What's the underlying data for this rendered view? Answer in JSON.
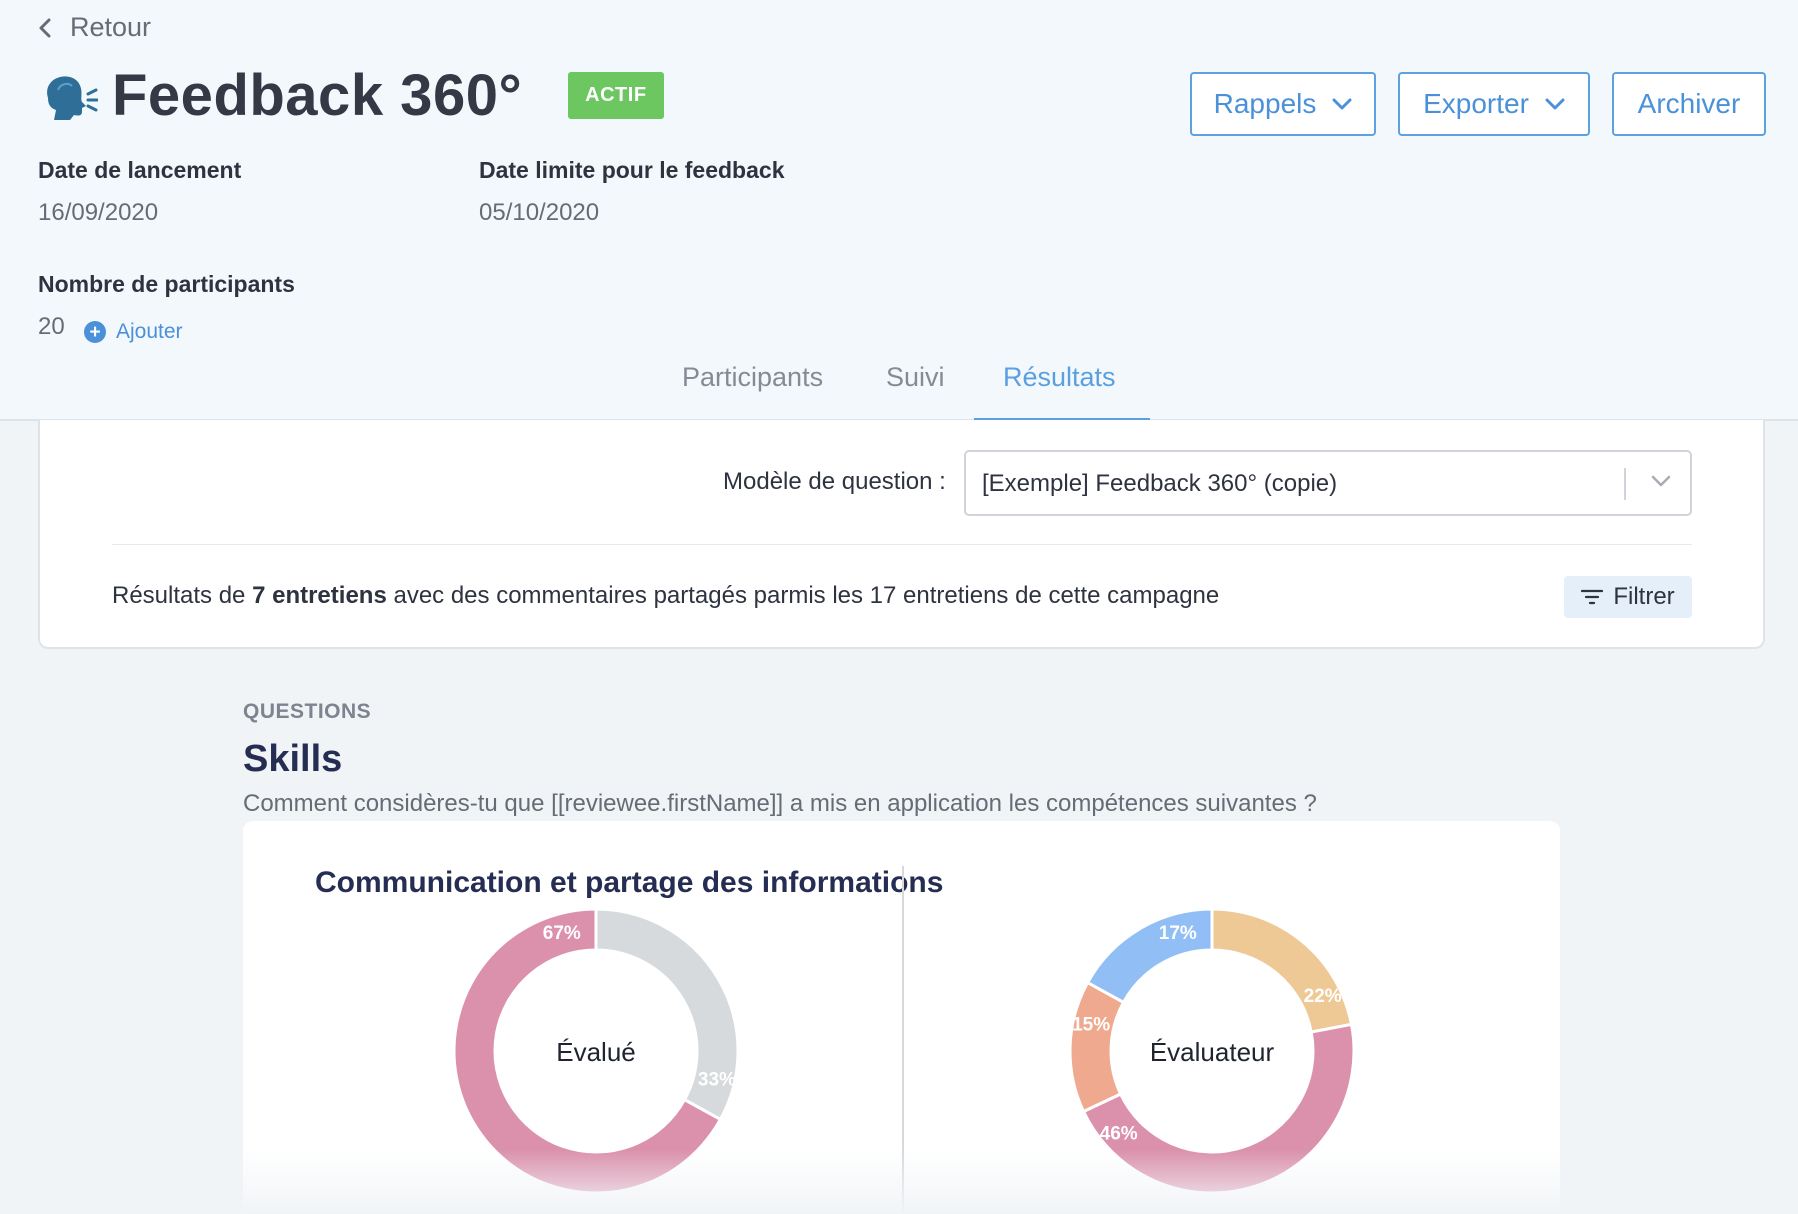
{
  "back": {
    "label": "Retour",
    "icon": "chevron-left-icon"
  },
  "title": {
    "emoji": "speaking-head-icon",
    "text": "Feedback 360°",
    "status": "ACTIF",
    "status_color": "#6cc760"
  },
  "actions": {
    "rappels": "Rappels",
    "exporter": "Exporter",
    "archiver": "Archiver",
    "accent_color": "#4a91d9"
  },
  "meta": {
    "launch_label": "Date de lancement",
    "launch_value": "16/09/2020",
    "deadline_label": "Date limite pour le feedback",
    "deadline_value": "05/10/2020",
    "participants_label": "Nombre de participants",
    "participants_value": "20",
    "add_label": "Ajouter"
  },
  "tabs": [
    {
      "label": "Participants",
      "active": false
    },
    {
      "label": "Suivi",
      "active": false
    },
    {
      "label": "Résultats",
      "active": true
    }
  ],
  "filters": {
    "model_label": "Modèle de question :",
    "model_value": "[Exemple] Feedback 360° (copie)",
    "results_prefix": "Résultats de ",
    "results_bold": "7 entretiens",
    "results_suffix": " avec des commentaires partagés parmis les 17 entretiens de cette campagne",
    "filter_label": "Filtrer"
  },
  "questions": {
    "section_label": "QUESTIONS",
    "title": "Skills",
    "description": "Comment considères-tu que [[reviewee.firstName]] a mis en application les compétences suivantes ?"
  },
  "chart_data": [
    {
      "type": "pie",
      "title": "Communication et partage des informations",
      "center_label": "Évalué",
      "slices": [
        {
          "value": 33,
          "label": "33%",
          "color": "#d6dadd"
        },
        {
          "value": 67,
          "label": "67%",
          "color": "#db91ac"
        }
      ]
    },
    {
      "type": "pie",
      "title": "",
      "center_label": "Évaluateur",
      "slices": [
        {
          "value": 22,
          "label": "22%",
          "color": "#efc995"
        },
        {
          "value": 46,
          "label": "46%",
          "color": "#db91ac"
        },
        {
          "value": 15,
          "label": "15%",
          "color": "#efa98f"
        },
        {
          "value": 17,
          "label": "17%",
          "color": "#91bff5"
        }
      ]
    }
  ]
}
